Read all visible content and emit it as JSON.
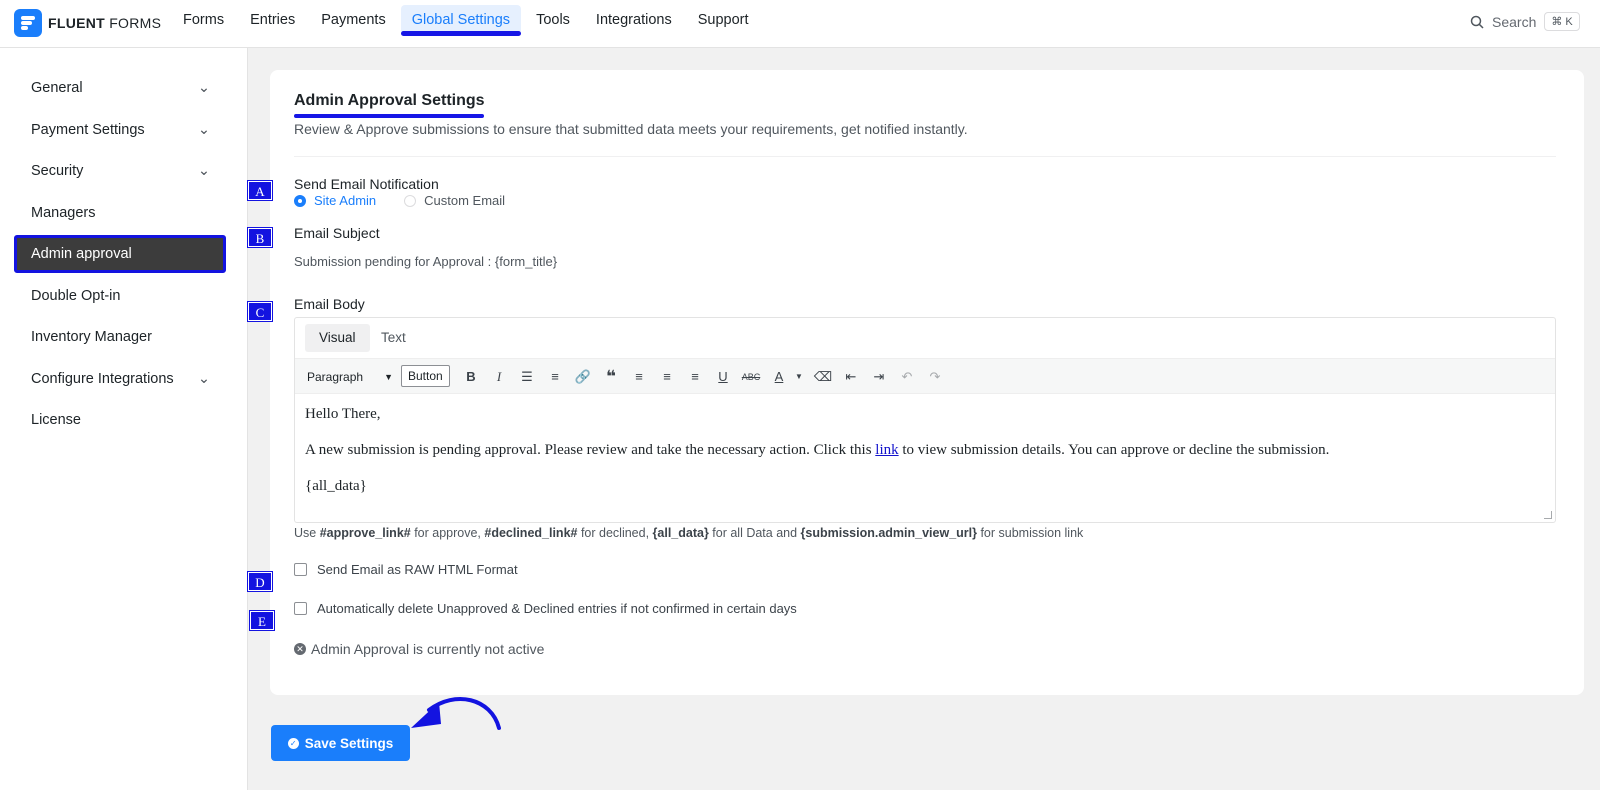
{
  "brand": {
    "name_bold": "FLUENT",
    "name_light": " FORMS"
  },
  "nav": [
    {
      "label": "Forms"
    },
    {
      "label": "Entries"
    },
    {
      "label": "Payments"
    },
    {
      "label": "Global Settings"
    },
    {
      "label": "Tools"
    },
    {
      "label": "Integrations"
    },
    {
      "label": "Support"
    }
  ],
  "search": {
    "label": "Search",
    "shortcut": "⌘ K"
  },
  "sidebar": [
    {
      "label": "General",
      "chevron": true
    },
    {
      "label": "Payment Settings",
      "chevron": true
    },
    {
      "label": "Security",
      "chevron": true
    },
    {
      "label": "Managers",
      "chevron": false
    },
    {
      "label": "Admin approval",
      "chevron": false,
      "active": true
    },
    {
      "label": "Double Opt-in",
      "chevron": false
    },
    {
      "label": "Inventory Manager",
      "chevron": false
    },
    {
      "label": "Configure Integrations",
      "chevron": true
    },
    {
      "label": "License",
      "chevron": false
    }
  ],
  "settings": {
    "title": "Admin Approval Settings",
    "subtitle": "Review & Approve submissions to ensure that submitted data meets your requirements, get notified instantly.",
    "notification_label": "Send Email Notification",
    "radio_site_admin": "Site Admin",
    "radio_custom_email": "Custom Email",
    "selected_recipient": "Site Admin",
    "subject_label": "Email Subject",
    "subject_value": "Submission pending for Approval : {form_title}",
    "body_label": "Email Body",
    "tab_visual": "Visual",
    "tab_text": "Text",
    "format_select": "Paragraph",
    "format_button": "Button",
    "body_line1": "Hello There,",
    "body_line2_before": "A new submission is pending approval. Please review and take the necessary action. Click this ",
    "body_line2_link": "link",
    "body_line2_after": " to view submission details. You can approve or decline the submission.",
    "body_line3": "{all_data}",
    "hint_use": "Use ",
    "hint_approve": "#approve_link#",
    "hint_for_approve": " for approve, ",
    "hint_declined": "#declined_link#",
    "hint_for_declined": " for declined, ",
    "hint_all_data": "{all_data}",
    "hint_for_all": " for all Data and ",
    "hint_url": "{submission.admin_view_url}",
    "hint_for_link": " for submission link",
    "raw_html_label": "Send Email as RAW HTML Format",
    "raw_html_checked": false,
    "auto_delete_label": "Automatically delete Unapproved & Declined entries if not confirmed in certain days",
    "auto_delete_checked": false,
    "status_text": "Admin Approval is currently not active",
    "save_label": "Save Settings"
  },
  "markers": [
    "A",
    "B",
    "C",
    "D",
    "E"
  ],
  "colors": {
    "accent": "#1a7efb",
    "annotation": "#1313e0"
  }
}
